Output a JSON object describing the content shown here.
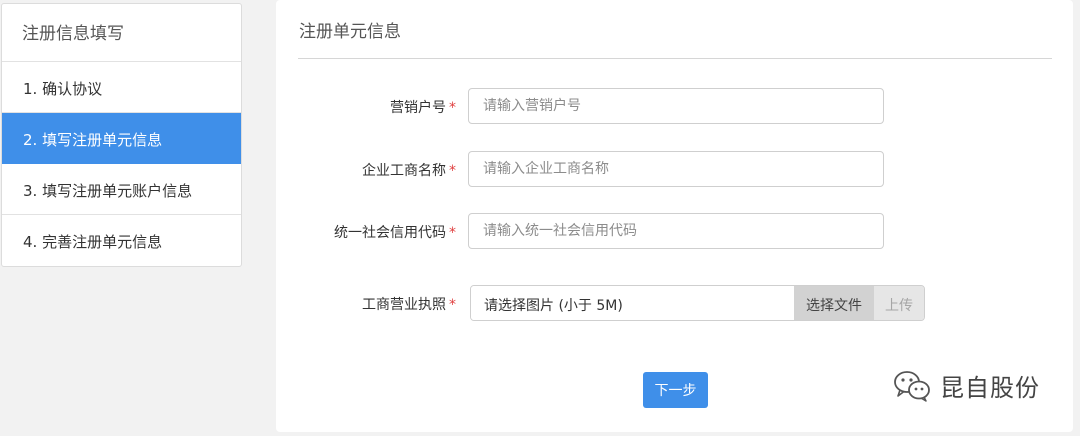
{
  "sidebar": {
    "title": "注册信息填写",
    "items": [
      {
        "label": "1. 确认协议",
        "active": false
      },
      {
        "label": "2. 填写注册单元信息",
        "active": true
      },
      {
        "label": "3. 填写注册单元账户信息",
        "active": false
      },
      {
        "label": "4. 完善注册单元信息",
        "active": false
      }
    ]
  },
  "panel": {
    "title": "注册单元信息",
    "required_mark": "*",
    "fields": [
      {
        "label": "营销户号",
        "placeholder": "请输入营销户号"
      },
      {
        "label": "企业工商名称",
        "placeholder": "请输入企业工商名称"
      },
      {
        "label": "统一社会信用代码",
        "placeholder": "请输入统一社会信用代码"
      }
    ],
    "file_field": {
      "label": "工商营业执照",
      "display_text": "请选择图片 (小于 5M)",
      "choose_label": "选择文件",
      "upload_label": "上传"
    },
    "next_label": "下一步"
  },
  "watermark": {
    "text": "昆自股份",
    "icon": "wechat-icon"
  },
  "colors": {
    "accent": "#3f8fe9",
    "required": "#e04040",
    "background": "#f2f2f2"
  }
}
